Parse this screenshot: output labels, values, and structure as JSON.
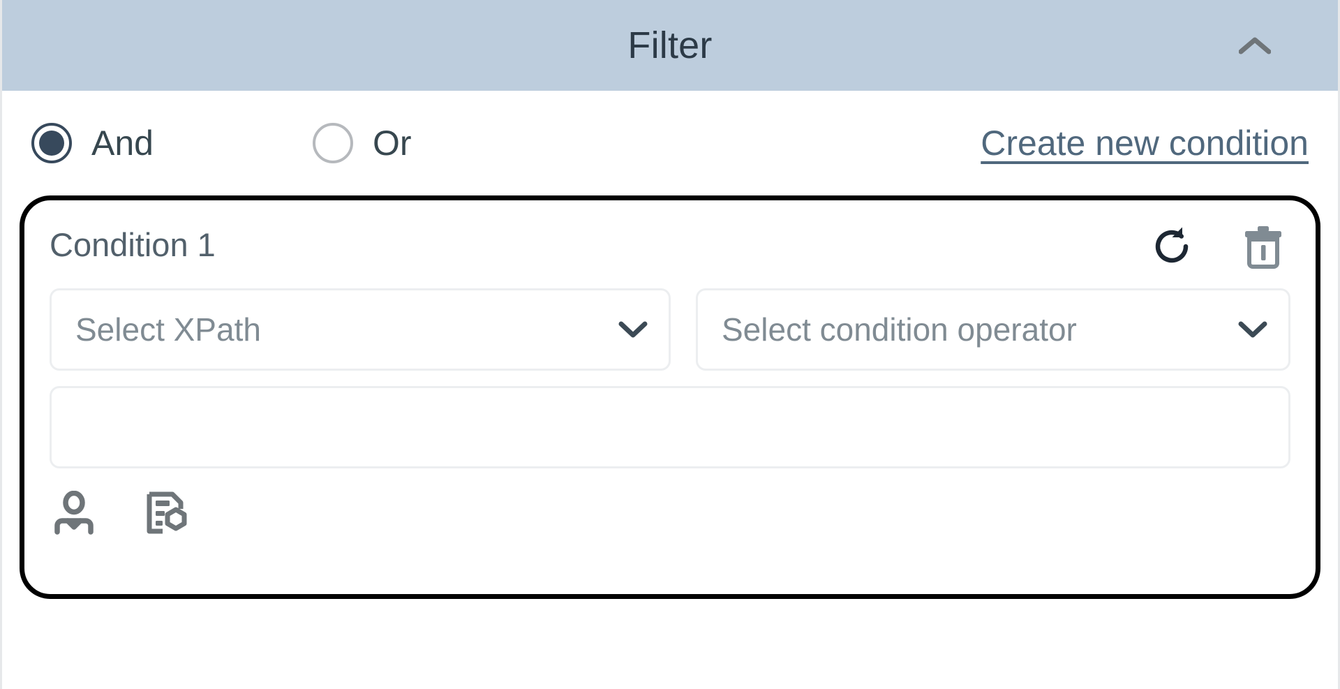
{
  "header": {
    "title": "Filter",
    "collapse_icon": "chevron-up-icon",
    "background_color": "#bdcddd",
    "title_color": "#2c3a47"
  },
  "logic": {
    "options": [
      {
        "label": "And",
        "value": "and",
        "selected": true
      },
      {
        "label": "Or",
        "value": "or",
        "selected": false
      }
    ],
    "selected_value": "and",
    "selected_color": "#37495c",
    "unselected_color": "#b6b9bd"
  },
  "actions": {
    "create_condition_label": "Create new condition",
    "link_color": "#50687d"
  },
  "condition": {
    "name": "Condition 1",
    "refresh_icon": "refresh-icon",
    "delete_icon": "trash-icon",
    "focus_border_color": "#000000",
    "xpath_select": {
      "icon": "chevron-down-icon",
      "placeholder": "Select XPath",
      "value": ""
    },
    "operator_select": {
      "icon": "chevron-down-icon",
      "placeholder": "Select condition operator",
      "value": ""
    },
    "value_input": {
      "placeholder": "",
      "value": ""
    },
    "footer_icons": [
      {
        "name": "user-icon"
      },
      {
        "name": "document-rules-icon"
      }
    ]
  }
}
